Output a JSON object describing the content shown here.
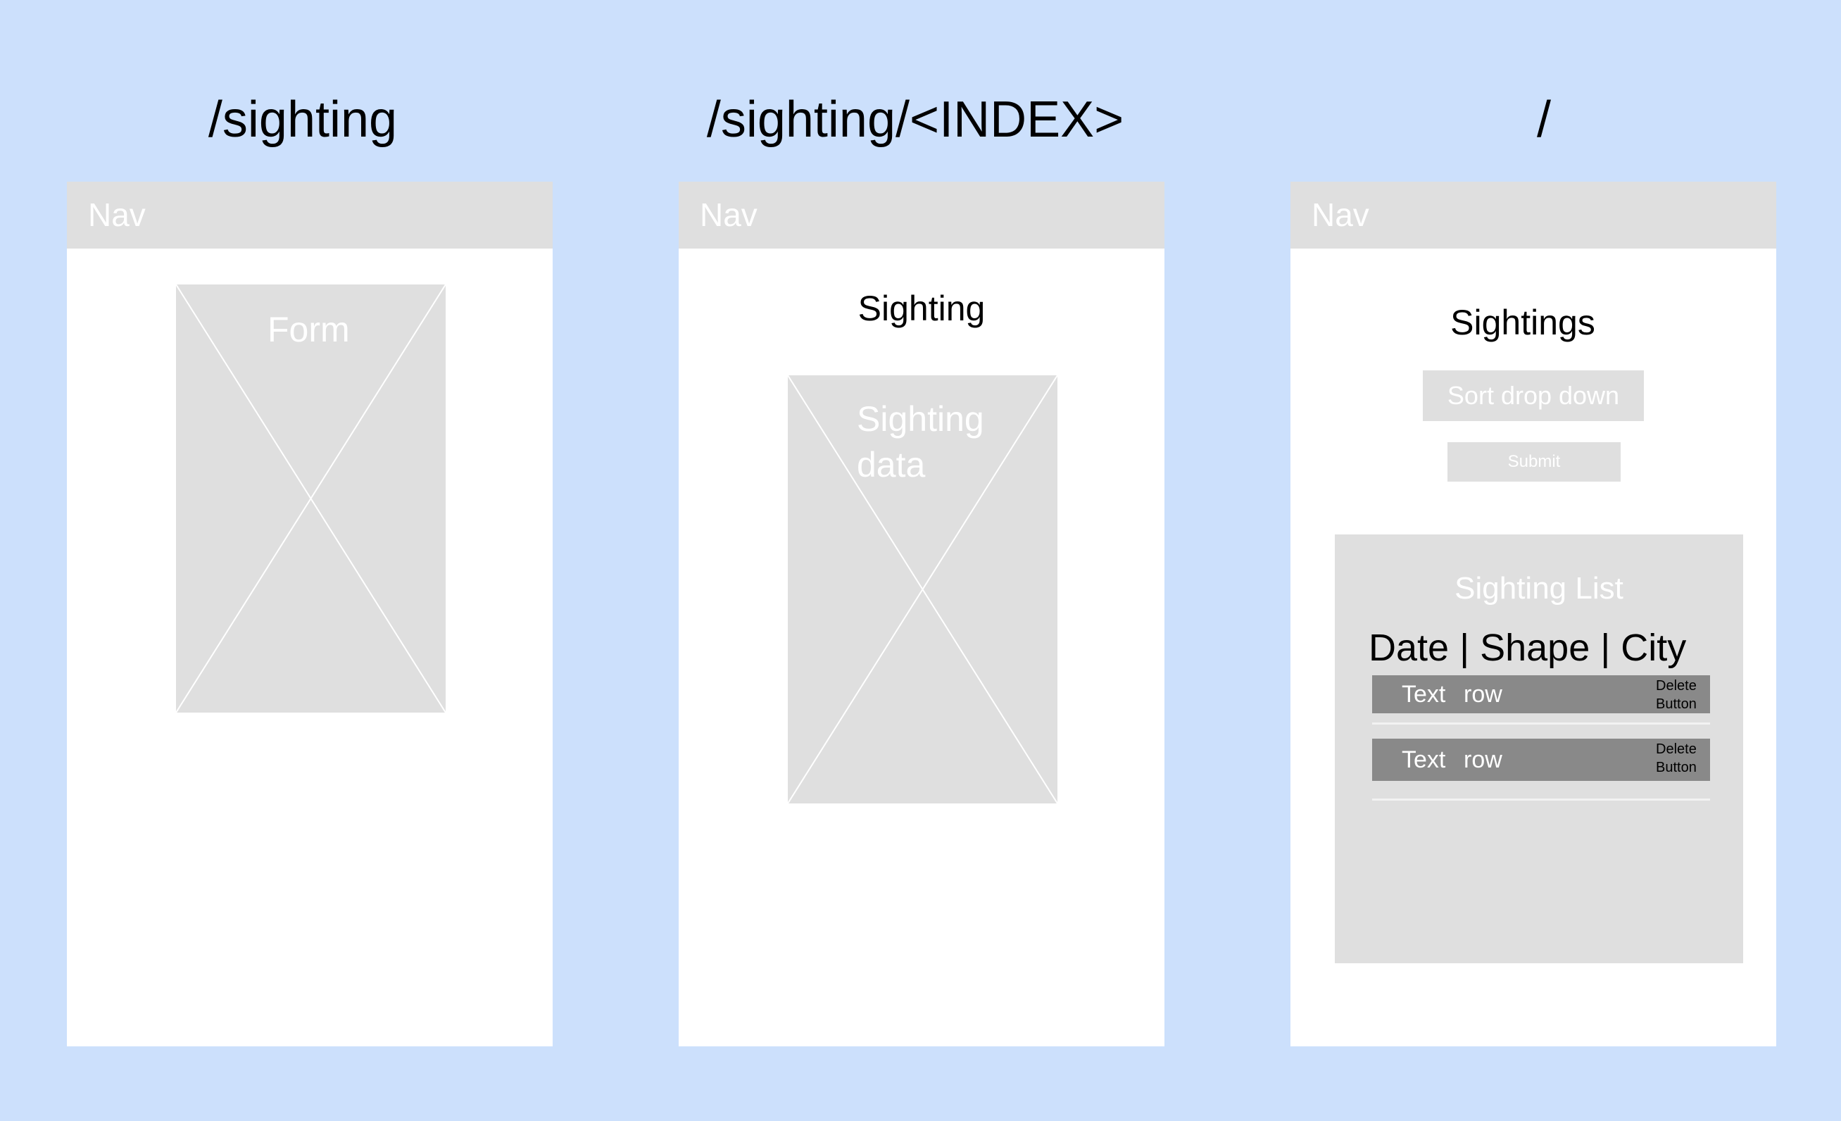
{
  "routes": [
    {
      "path": "/sighting",
      "nav_label": "Nav",
      "placeholder_label": "Form"
    },
    {
      "path": "/sighting/<INDEX>",
      "nav_label": "Nav",
      "heading": "Sighting",
      "placeholder_label_line1": "Sighting",
      "placeholder_label_line2": "data"
    },
    {
      "path": "/",
      "nav_label": "Nav",
      "heading": "Sightings",
      "sort_label": "Sort drop down",
      "submit_label": "Submit",
      "list": {
        "title": "Sighting List",
        "header": "Date | Shape | City",
        "rows": [
          {
            "col1": "Text",
            "col2": "row",
            "delete_line1": "Delete",
            "delete_line2": "Button"
          },
          {
            "col1": "Text",
            "col2": "row",
            "delete_line1": "Delete",
            "delete_line2": "Button"
          }
        ]
      }
    }
  ],
  "colors": {
    "background": "#cce0fc",
    "screen": "#ffffff",
    "placeholder": "#dfdfdf",
    "row": "#898989"
  }
}
